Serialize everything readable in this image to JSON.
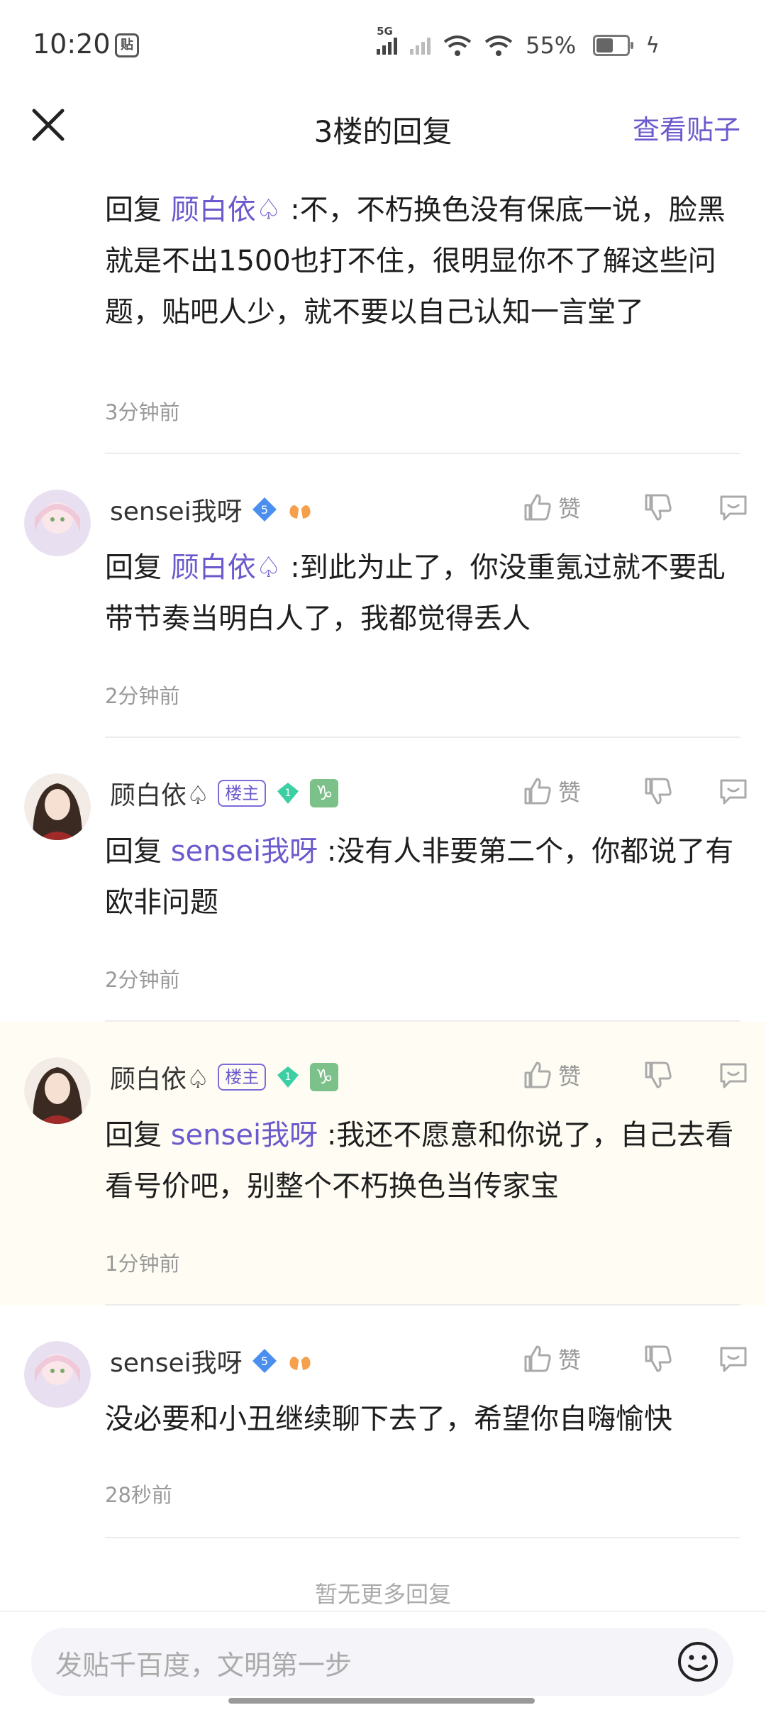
{
  "status_bar": {
    "time": "10:20",
    "notif_icon_label": "贴",
    "network": "5G",
    "battery": "55%",
    "battery_level": 0.55
  },
  "header": {
    "title": "3楼的回复",
    "view_post_label": "查看贴子"
  },
  "actions": {
    "like_label": "赞"
  },
  "first_reply": {
    "prefix": "回复",
    "mention": "顾白依♤",
    "text": ":不，不朽换色没有保底一说，脸黑就是不出1500也打不住，很明显你不了解这些问题，贴吧人少，就不要以自己认知一言堂了",
    "time": "3分钟前"
  },
  "comments": [
    {
      "username": "sensei我呀",
      "level": "5",
      "is_owner": false,
      "prefix": "回复",
      "mention": "顾白依♤",
      "text": ":到此为止了，你没重氪过就不要乱带节奏当明白人了，我都觉得丢人",
      "time": "2分钟前"
    },
    {
      "username": "顾白依♤",
      "level": "1",
      "owner_badge": "楼主",
      "is_owner": true,
      "prefix": "回复",
      "mention": "sensei我呀",
      "text": ":没有人非要第二个，你都说了有欧非问题",
      "time": "2分钟前"
    },
    {
      "username": "顾白依♤",
      "level": "1",
      "owner_badge": "楼主",
      "is_owner": true,
      "prefix": "回复",
      "mention": "sensei我呀",
      "text": ":我还不愿意和你说了，自己去看看号价吧，别整个不朽换色当传家宝",
      "time": "1分钟前"
    },
    {
      "username": "sensei我呀",
      "level": "5",
      "is_owner": false,
      "text": "没必要和小丑继续聊下去了，希望你自嗨愉快",
      "time": "28秒前"
    }
  ],
  "no_more_replies": "暂无更多回复",
  "input": {
    "placeholder": "发贴千百度，文明第一步"
  },
  "colors": {
    "accent": "#6a5acd",
    "highlight_bg": "#fffdf3"
  }
}
